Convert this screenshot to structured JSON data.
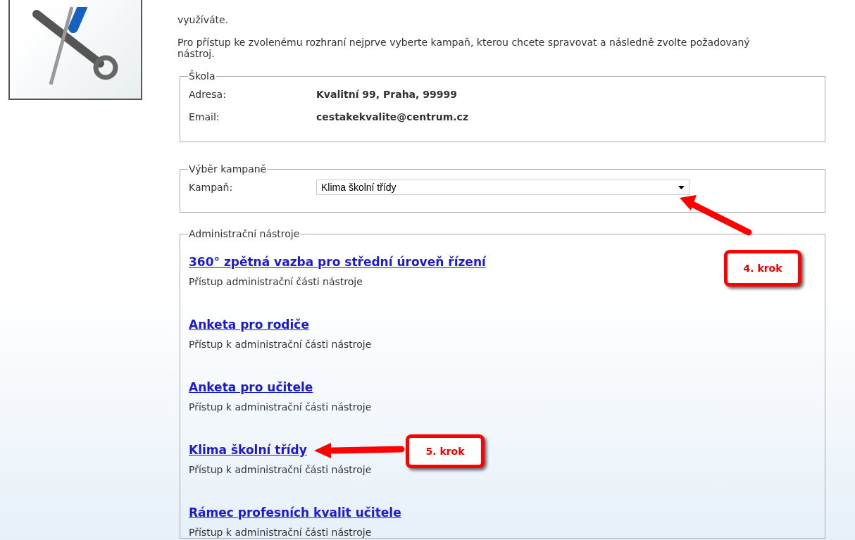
{
  "intro": [
    "využíváte.",
    "Pro přístup ke zvolenému rozhraní nejprve vyberte kampaň, kterou chcete spravovat a následně zvolte požadovaný nástroj."
  ],
  "school": {
    "legend": "Škola",
    "rows": [
      {
        "label": "Adresa:",
        "value": "Kvalitní 99, Praha, 99999"
      },
      {
        "label": "Email:",
        "value": "cestakekvalite@centrum.cz"
      }
    ]
  },
  "campaign": {
    "legend": "Výběr kampaně",
    "label": "Kampaň:",
    "value": "Klima školní třídy"
  },
  "tools": {
    "legend": "Administrační nástroje",
    "items": [
      {
        "title": "360° zpětná vazba pro střední úroveň řízení",
        "description": "Přístup administrační části nástroje"
      },
      {
        "title": "Anketa pro rodiče",
        "description": "Přístup k administrační části nástroje"
      },
      {
        "title": "Anketa pro učitele",
        "description": "Přístup k administrační části nástroje"
      },
      {
        "title": "Klima školní třídy",
        "description": "Přístup k administrační části nástroje"
      },
      {
        "title": "Rámec profesních kvalit učitele",
        "description": "Přístup k administrační části nástroje"
      }
    ]
  },
  "callouts": [
    {
      "label": "4. krok",
      "kind": "upleft"
    },
    {
      "label": "5. krok",
      "kind": "left"
    }
  ]
}
